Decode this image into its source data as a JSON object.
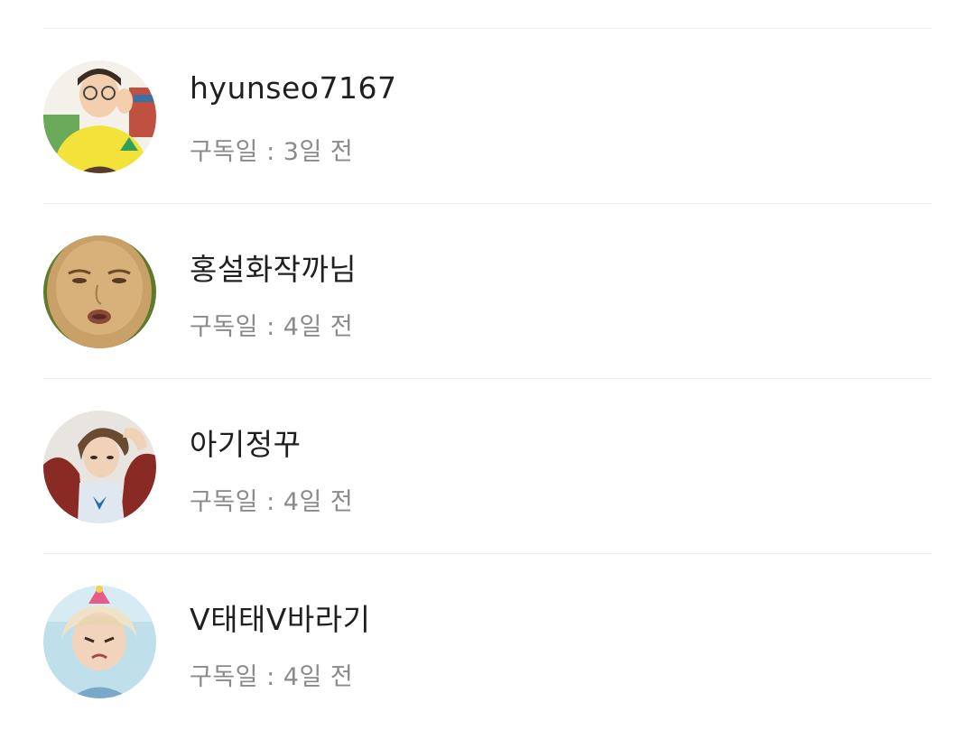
{
  "subscribers": [
    {
      "name": "hyunseo7167",
      "date": "구독일 : 3일 전"
    },
    {
      "name": "홍설화작까님",
      "date": "구독일 : 4일 전"
    },
    {
      "name": "아기정꾸",
      "date": "구독일 : 4일 전"
    },
    {
      "name": "V태태V바라기",
      "date": "구독일 : 4일 전"
    }
  ]
}
